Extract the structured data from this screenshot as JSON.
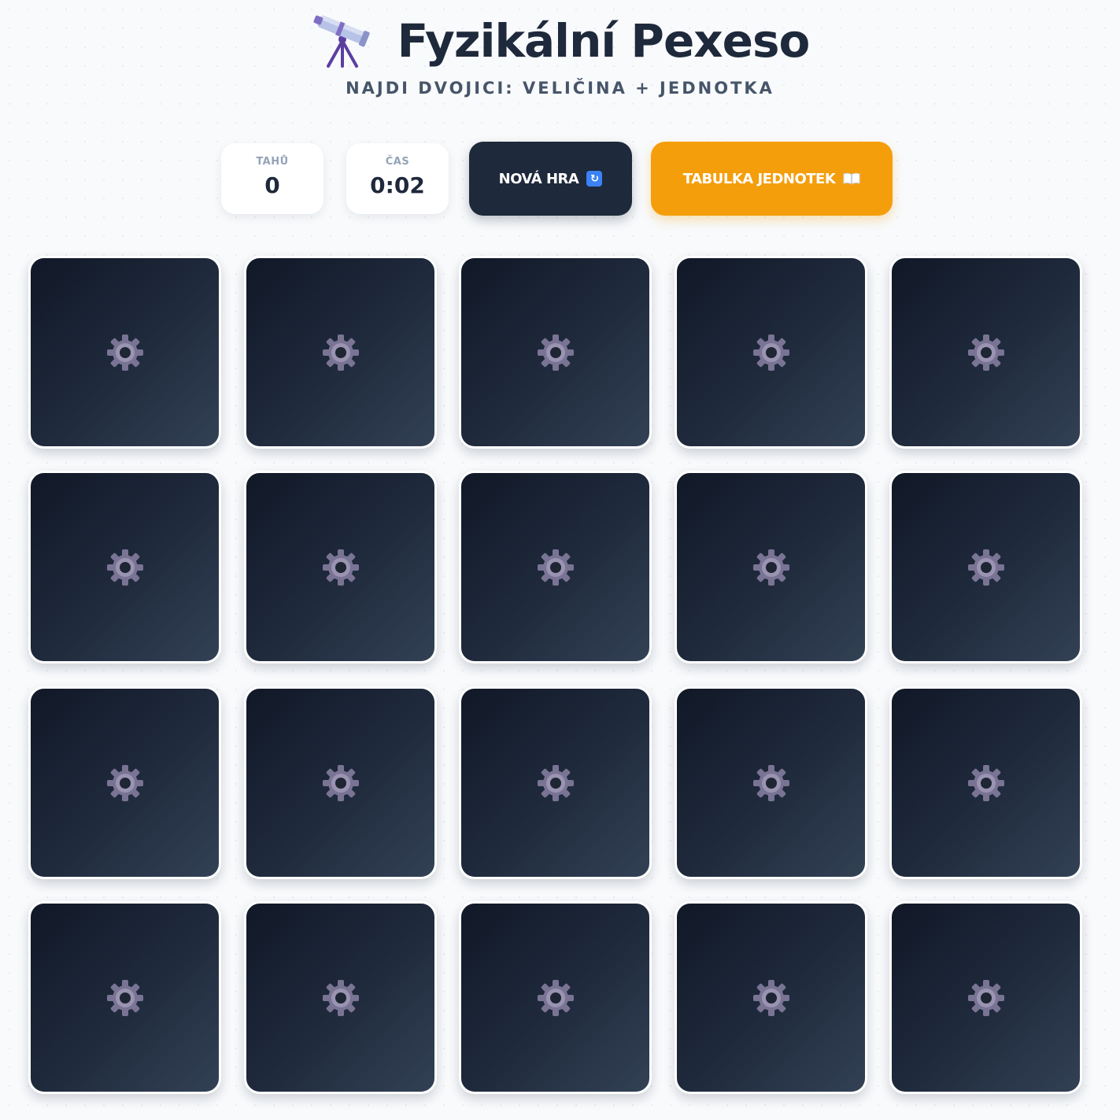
{
  "header": {
    "icon": "telescope-icon",
    "title": "Fyzikální Pexeso",
    "subtitle": "NAJDI DVOJICI: VELIČINA + JEDNOTKA"
  },
  "stats": {
    "moves_label": "TAHŮ",
    "moves_value": "0",
    "time_label": "ČAS",
    "time_value": "0:02"
  },
  "buttons": {
    "new_game_label": "NOVÁ HRA",
    "new_game_icon": "refresh-icon",
    "unit_table_label": "TABULKA JEDNOTEK",
    "unit_table_icon": "book-icon"
  },
  "board": {
    "rows": 4,
    "columns": 5,
    "card_back_icon": "gear-icon",
    "cards_face_down": 20
  },
  "colors": {
    "card_back": "#1e293b",
    "primary_button": "#1e293b",
    "accent_button": "#f59e0b",
    "gear": "#7a7494"
  }
}
